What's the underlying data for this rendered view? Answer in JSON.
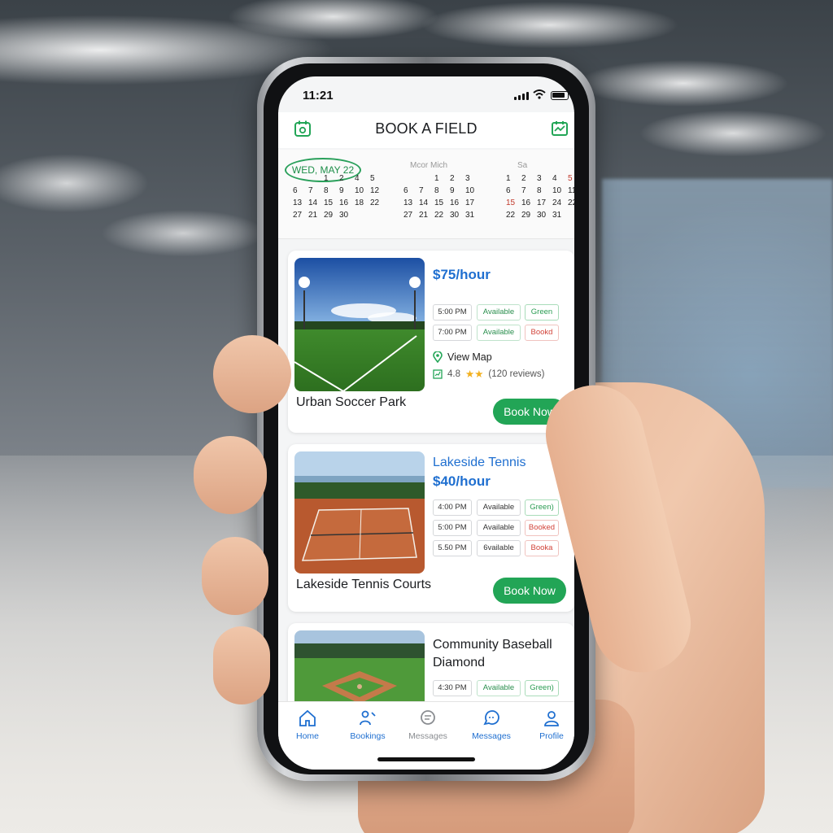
{
  "status_bar": {
    "time": "11:21"
  },
  "header": {
    "title": "BOOK A FIELD"
  },
  "calendar": {
    "selected_date": "WED, MAY 22",
    "month2_label": "Mcor Mich",
    "month3_label": "Sa",
    "month1_rows": [
      [
        "",
        "",
        "1",
        "2",
        "4",
        "5"
      ],
      [
        "6",
        "7",
        "8",
        "9",
        "10",
        "12"
      ],
      [
        "13",
        "14",
        "15",
        "16",
        "18",
        "22"
      ],
      [
        "27",
        "21",
        "29",
        "30",
        "",
        ""
      ]
    ],
    "month2_rows": [
      [
        "",
        "",
        "1",
        "2",
        "3",
        ""
      ],
      [
        "6",
        "7",
        "8",
        "9",
        "10",
        ""
      ],
      [
        "13",
        "14",
        "15",
        "16",
        "17",
        ""
      ],
      [
        "27",
        "21",
        "22",
        "30",
        "31",
        ""
      ]
    ],
    "month3_rows": [
      [
        "1",
        "2",
        "3",
        "4",
        "5",
        ""
      ],
      [
        "6",
        "7",
        "8",
        "10",
        "11",
        "13"
      ],
      [
        "15",
        "16",
        "17",
        "24",
        "22",
        ""
      ],
      [
        "22",
        "29",
        "30",
        "31",
        "",
        ""
      ]
    ]
  },
  "venues": [
    {
      "name": "Urban Soccer Park",
      "price": "$75/hour",
      "slots": [
        {
          "time": "5:00 PM",
          "status": "Available",
          "tag": "Green"
        },
        {
          "time": "7:00 PM",
          "status": "Available",
          "tag": "Bookd"
        }
      ],
      "view_map": "View Map",
      "rating": "4.8",
      "reviews": "(120 reviews)",
      "book": "Book Now"
    },
    {
      "name": "Lakeside Tennis Courts",
      "title_right": "Lakeside Tennis",
      "price": "$40/hour",
      "slots": [
        {
          "time": "4:00 PM",
          "status": "Available",
          "tag": "Green)"
        },
        {
          "time": "5:00 PM",
          "status": "Available",
          "tag": "Booked"
        },
        {
          "time": "5.50 PM",
          "status": "6vailable",
          "tag": "Booka"
        }
      ],
      "book": "Book Now"
    },
    {
      "name_line1": "Community Baseball",
      "name_line2": "Diamond",
      "slots": [
        {
          "time": "4:30 PM",
          "status": "Available",
          "tag": "Green)"
        }
      ]
    }
  ],
  "tabs": [
    {
      "label": "Home",
      "icon": "home-icon"
    },
    {
      "label": "Bookings",
      "icon": "bookings-icon"
    },
    {
      "label": "Messages",
      "icon": "chat-icon"
    },
    {
      "label": "Messages",
      "icon": "message-icon"
    },
    {
      "label": "Profile",
      "icon": "profile-icon"
    }
  ],
  "colors": {
    "accent_green": "#22a556",
    "accent_blue": "#1f6fd0",
    "booked_red": "#d2443a"
  }
}
